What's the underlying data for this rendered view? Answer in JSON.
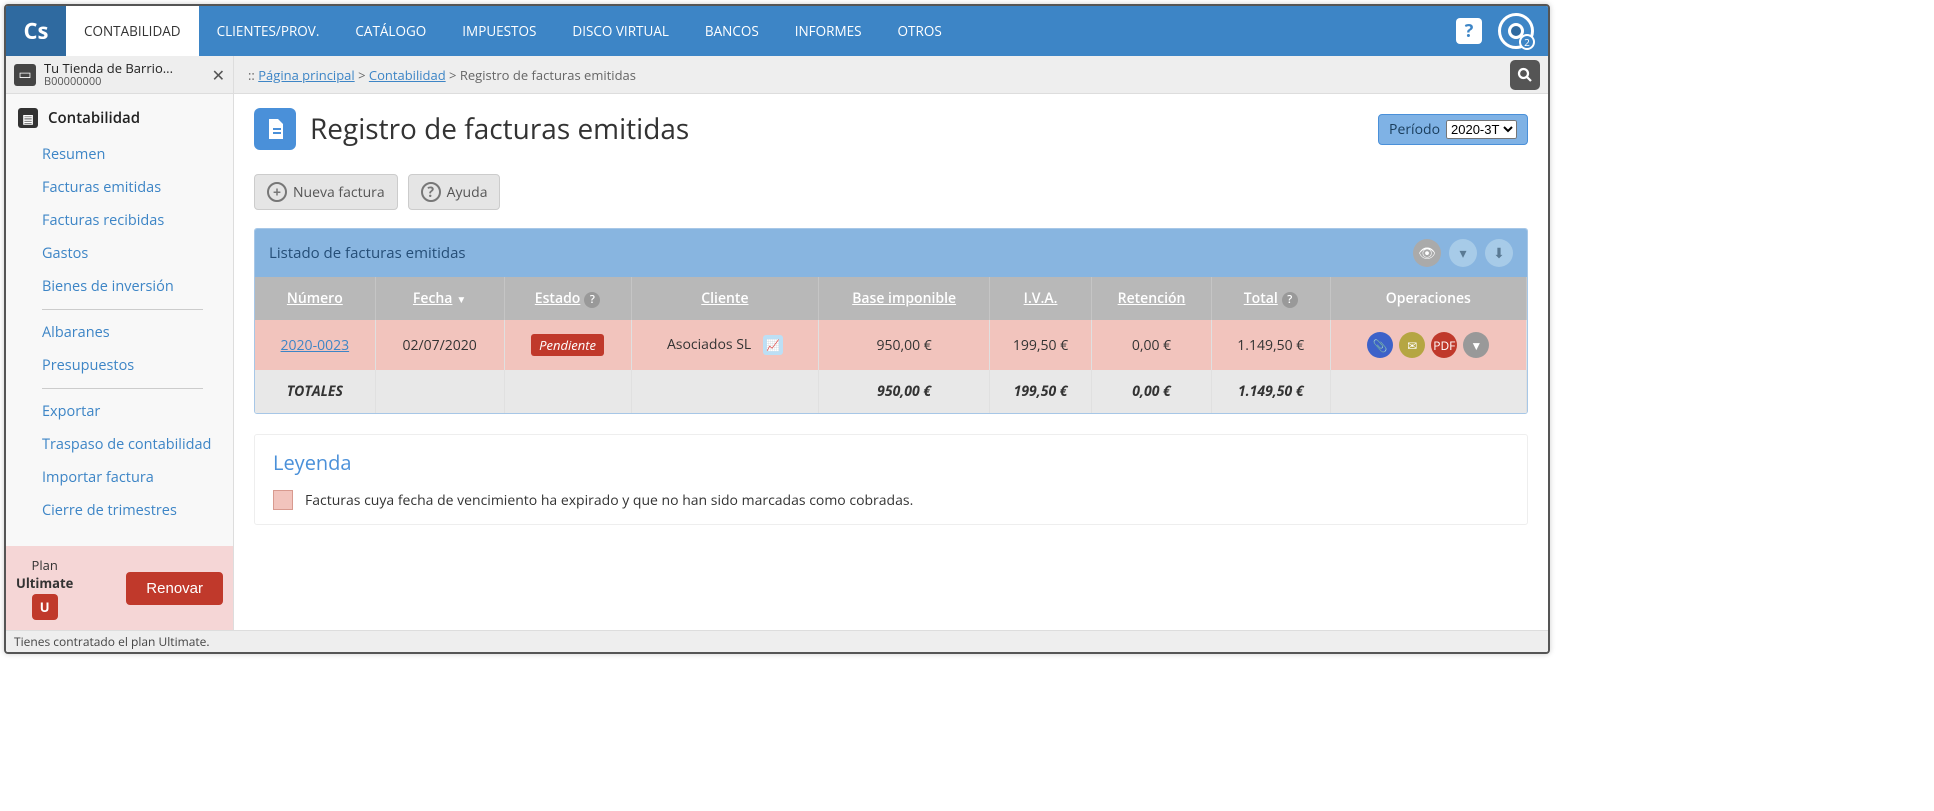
{
  "topnav": {
    "logo": "Cs",
    "items": [
      "CONTABILIDAD",
      "CLIENTES/PROV.",
      "CATÁLOGO",
      "IMPUESTOS",
      "DISCO VIRTUAL",
      "BANCOS",
      "INFORMES",
      "OTROS"
    ],
    "active_index": 0,
    "help": "?",
    "notif_count": "2"
  },
  "company": {
    "name": "Tu Tienda de Barrio...",
    "code": "B00000000"
  },
  "breadcrumb": {
    "prefix": ":: ",
    "home": "Página principal",
    "sep": " > ",
    "section": "Contabilidad",
    "current": "Registro de facturas emitidas"
  },
  "sidebar": {
    "title": "Contabilidad",
    "groups": [
      [
        "Resumen",
        "Facturas emitidas",
        "Facturas recibidas",
        "Gastos",
        "Bienes de inversión"
      ],
      [
        "Albaranes",
        "Presupuestos"
      ],
      [
        "Exportar",
        "Traspaso de contabilidad",
        "Importar factura",
        "Cierre de trimestres"
      ]
    ],
    "plan_label": "Plan",
    "plan_name": "Ultimate",
    "plan_badge": "U",
    "renew_label": "Renovar"
  },
  "statusbar": "Tienes contratado el plan Ultimate.",
  "page": {
    "title": "Registro de facturas emitidas",
    "period_label": "Período",
    "period_value": "2020-3T"
  },
  "toolbar": {
    "new_invoice": "Nueva factura",
    "help": "Ayuda"
  },
  "panel": {
    "title": "Listado de facturas emitidas",
    "columns": {
      "numero": "Número",
      "fecha": "Fecha",
      "estado": "Estado",
      "cliente": "Cliente",
      "base": "Base imponible",
      "iva": "I.V.A.",
      "retencion": "Retención",
      "total": "Total",
      "ops": "Operaciones"
    },
    "rows": [
      {
        "numero": "2020-0023",
        "fecha": "02/07/2020",
        "estado": "Pendiente",
        "cliente": "Asociados SL",
        "base": "950,00 €",
        "iva": "199,50 €",
        "retencion": "0,00 €",
        "total": "1.149,50 €",
        "expired": true
      }
    ],
    "totals_label": "TOTALES",
    "totals": {
      "base": "950,00 €",
      "iva": "199,50 €",
      "retencion": "0,00 €",
      "total": "1.149,50 €"
    }
  },
  "legend": {
    "title": "Leyenda",
    "item": "Facturas cuya fecha de vencimiento ha expirado y que no han sido marcadas como cobradas."
  }
}
